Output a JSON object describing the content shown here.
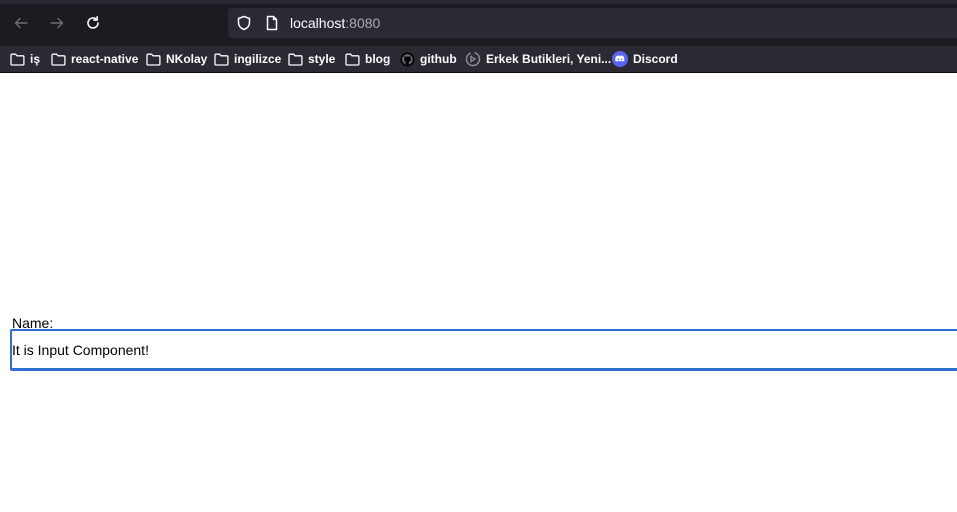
{
  "browser": {
    "url_host": "localhost",
    "url_port": ":8080",
    "icons": {
      "back": "arrow-left-icon",
      "forward": "arrow-right-icon",
      "reload": "reload-icon",
      "shield": "shield-icon",
      "page": "page-icon"
    }
  },
  "bookmarks": [
    {
      "label": "iş",
      "icon": "folder-icon"
    },
    {
      "label": "react-native",
      "icon": "folder-icon"
    },
    {
      "label": "NKolay",
      "icon": "folder-icon"
    },
    {
      "label": "ingilizce",
      "icon": "folder-icon"
    },
    {
      "label": "style",
      "icon": "folder-icon"
    },
    {
      "label": "blog",
      "icon": "folder-icon"
    },
    {
      "label": "github",
      "icon": "github-icon"
    },
    {
      "label": "Erkek Butikleri, Yeni...",
      "icon": "site-icon"
    },
    {
      "label": "Discord",
      "icon": "discord-icon"
    }
  ],
  "form": {
    "label": "Name:",
    "input_value": "It is Input Component!"
  },
  "colors": {
    "chrome_dark": "#1c1b22",
    "bookmarks_bar": "#2b2a33",
    "input_border": "#2f6fd0"
  }
}
